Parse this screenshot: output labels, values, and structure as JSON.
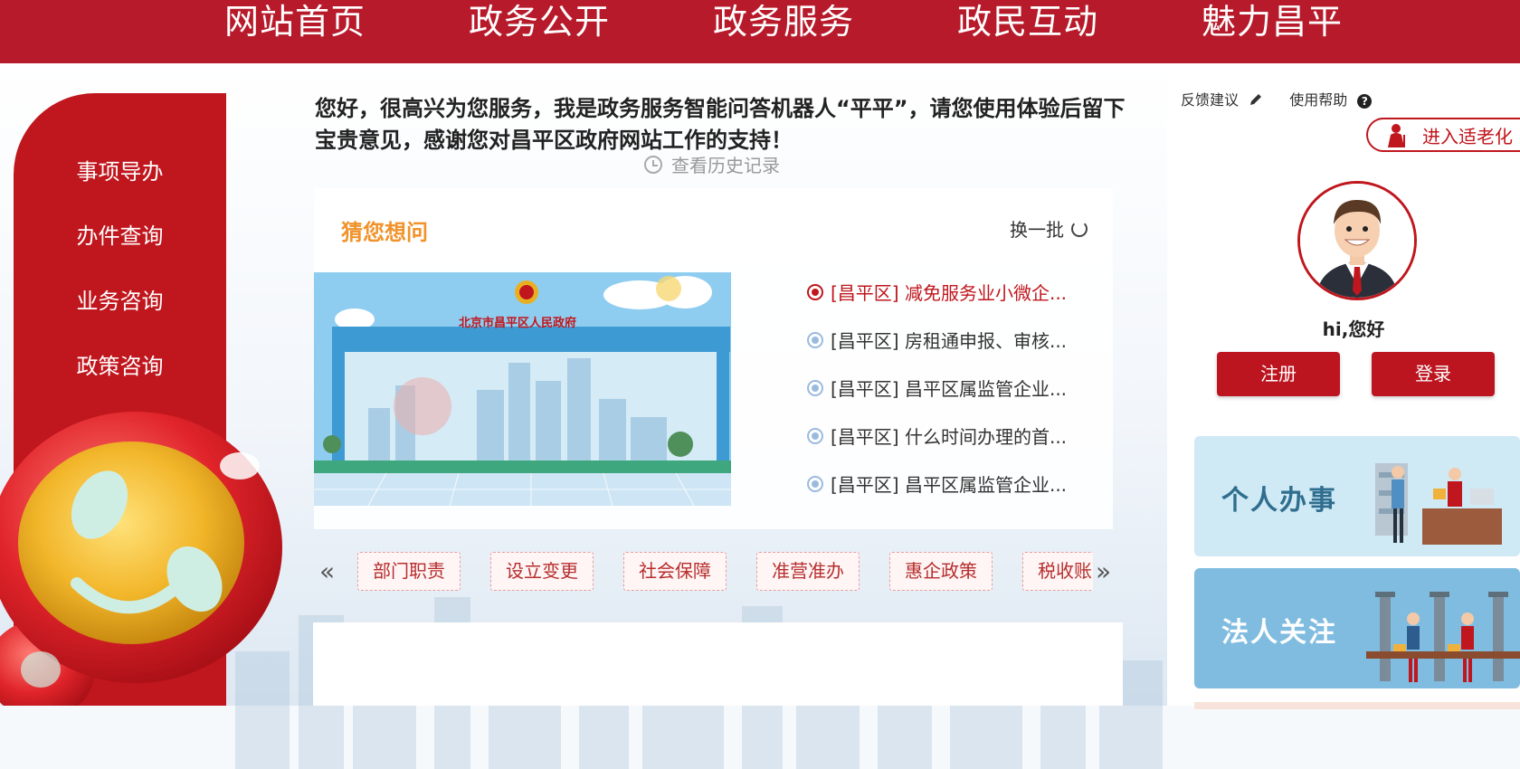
{
  "nav": {
    "items": [
      "网站首页",
      "政务公开",
      "政务服务",
      "政民互动",
      "魅力昌平"
    ]
  },
  "sidebar": {
    "items": [
      "事项导办",
      "办件查询",
      "业务咨询",
      "政策咨询"
    ]
  },
  "greeting": {
    "text": "您好，很高兴为您服务，我是政务服务智能问答机器人“平平”，请您使用体验后留下宝贵意见，感谢您对昌平区政府网站工作的支持！",
    "history_label": "查看历史记录"
  },
  "guess": {
    "title": "猜您想问",
    "refresh_label": "换一批",
    "banner_caption": "北京市昌平区人民政府",
    "questions": [
      "[昌平区] 减免服务业小微企...",
      "[昌平区] 房租通申报、审核...",
      "[昌平区] 昌平区属监管企业...",
      "[昌平区] 什么时间办理的首...",
      "[昌平区] 昌平区属监管企业..."
    ]
  },
  "tags": {
    "prev": "«",
    "next": "»",
    "items": [
      "部门职责",
      "设立变更",
      "社会保障",
      "准营准办",
      "惠企政策",
      "税收账"
    ]
  },
  "user": {
    "feedback_label": "反馈建议",
    "help_label": "使用帮助",
    "elder_label": "进入适老化",
    "greeting": "hi,您好",
    "register_label": "注册",
    "login_label": "登录"
  },
  "cards": {
    "personal": "个人办事",
    "legal": "法人关注"
  },
  "colors": {
    "brand_red": "#b71a2a",
    "accent_orange": "#f0932b",
    "question_blue": "#9bbbdd",
    "card_light_blue": "#cfe9f5",
    "card_blue": "#7fbce0"
  }
}
